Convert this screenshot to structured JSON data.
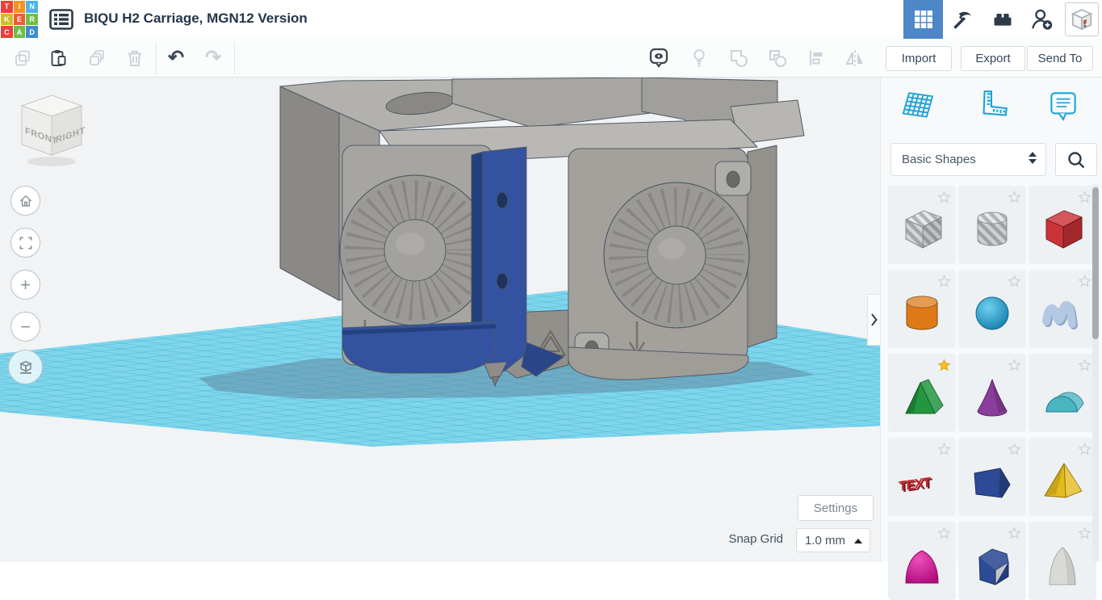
{
  "header": {
    "title": "BIQU H2 Carriage, MGN12 Version",
    "logo_letters": [
      {
        "ch": "T",
        "color": "#ee4036"
      },
      {
        "ch": "I",
        "color": "#f6921e"
      },
      {
        "ch": "N",
        "color": "#4ab5e6"
      },
      {
        "ch": "K",
        "color": "#cdbf2a"
      },
      {
        "ch": "E",
        "color": "#ee5b36"
      },
      {
        "ch": "R",
        "color": "#70bf44"
      },
      {
        "ch": "C",
        "color": "#ee4036"
      },
      {
        "ch": "A",
        "color": "#70bf44"
      },
      {
        "ch": "D",
        "color": "#3e8ecc"
      }
    ],
    "right_icons": [
      {
        "name": "dashboard-grid",
        "active": true
      },
      {
        "name": "minecraft-pickaxe",
        "active": false
      },
      {
        "name": "lego-brick",
        "active": false
      },
      {
        "name": "invite-person",
        "active": false
      },
      {
        "name": "sim-lab-box",
        "active": false
      }
    ]
  },
  "toolbar": {
    "left_icons": [
      {
        "name": "copy",
        "enabled": false
      },
      {
        "name": "paste",
        "enabled": true
      },
      {
        "name": "duplicate",
        "enabled": false
      },
      {
        "name": "delete",
        "enabled": false
      },
      {
        "name": "undo",
        "enabled": true
      },
      {
        "name": "redo",
        "enabled": false
      }
    ],
    "right_icons": [
      {
        "name": "show-hide",
        "enabled": true
      },
      {
        "name": "light-bulb",
        "enabled": false
      },
      {
        "name": "group",
        "enabled": false
      },
      {
        "name": "ungroup",
        "enabled": false
      },
      {
        "name": "align",
        "enabled": false
      },
      {
        "name": "mirror",
        "enabled": false
      }
    ],
    "undo_glyph": "↶",
    "redo_glyph": "↷",
    "buttons": {
      "import": "Import",
      "export": "Export",
      "send_to": "Send To"
    }
  },
  "viewcube": {
    "front": "FRONT",
    "right": "RIGHT"
  },
  "canvas": {
    "nav_buttons": [
      "home",
      "fit-view",
      "zoom-in",
      "zoom-out",
      "perspective-toggle"
    ],
    "zoom_in_symbol": "+",
    "zoom_out_symbol": "−",
    "settings_label": "Settings",
    "snap_grid_label": "Snap Grid",
    "snap_grid_value": "1.0 mm"
  },
  "panel": {
    "tabs": [
      "workplane",
      "ruler",
      "notes"
    ],
    "category_select": "Basic Shapes",
    "shapes": [
      {
        "name": "box-hole",
        "style": "hole-stripes",
        "favorited": false
      },
      {
        "name": "cylinder-hole",
        "style": "hole-stripes",
        "favorited": false
      },
      {
        "name": "box",
        "color": "#cc3338",
        "favorited": false
      },
      {
        "name": "cylinder",
        "color": "#dd7a17",
        "favorited": false
      },
      {
        "name": "sphere",
        "color": "#1f9ccc",
        "favorited": false
      },
      {
        "name": "scribble",
        "color": "#b3c9e3",
        "favorited": false
      },
      {
        "name": "roof",
        "color": "#22973f",
        "favorited": true
      },
      {
        "name": "cone",
        "color": "#8a3d9c",
        "favorited": false
      },
      {
        "name": "round-roof",
        "color": "#49b4c2",
        "favorited": false
      },
      {
        "name": "text",
        "color": "#c2272e",
        "favorited": false
      },
      {
        "name": "wedge",
        "color": "#2d4a96",
        "favorited": false
      },
      {
        "name": "pyramid",
        "color": "#e5bb1c",
        "favorited": false
      },
      {
        "name": "paraboloid",
        "color": "#d6129b",
        "favorited": false
      },
      {
        "name": "polygon",
        "color": "#2d4a96",
        "favorited": false
      },
      {
        "name": "cone-soft",
        "color": "#d9d9d6",
        "favorited": false
      }
    ]
  },
  "colors": {
    "accent_active_tab": "#4d87c7",
    "panel_icon": "#1ba3d6",
    "workplane": "#7fd6ec",
    "grid_line": "#3ea9cc",
    "shadow": "#5d7a93",
    "model_gray": "#a7a5a1",
    "model_gray_dark": "#8b8985",
    "model_blue": "#33529f",
    "model_blue_dark": "#243f7e",
    "star_active": "#f6c026",
    "star_inactive_stroke": "#ccd2d7",
    "hole_stripe_light": "#e6e8ea",
    "hole_stripe_dark": "#b0b4b8"
  }
}
